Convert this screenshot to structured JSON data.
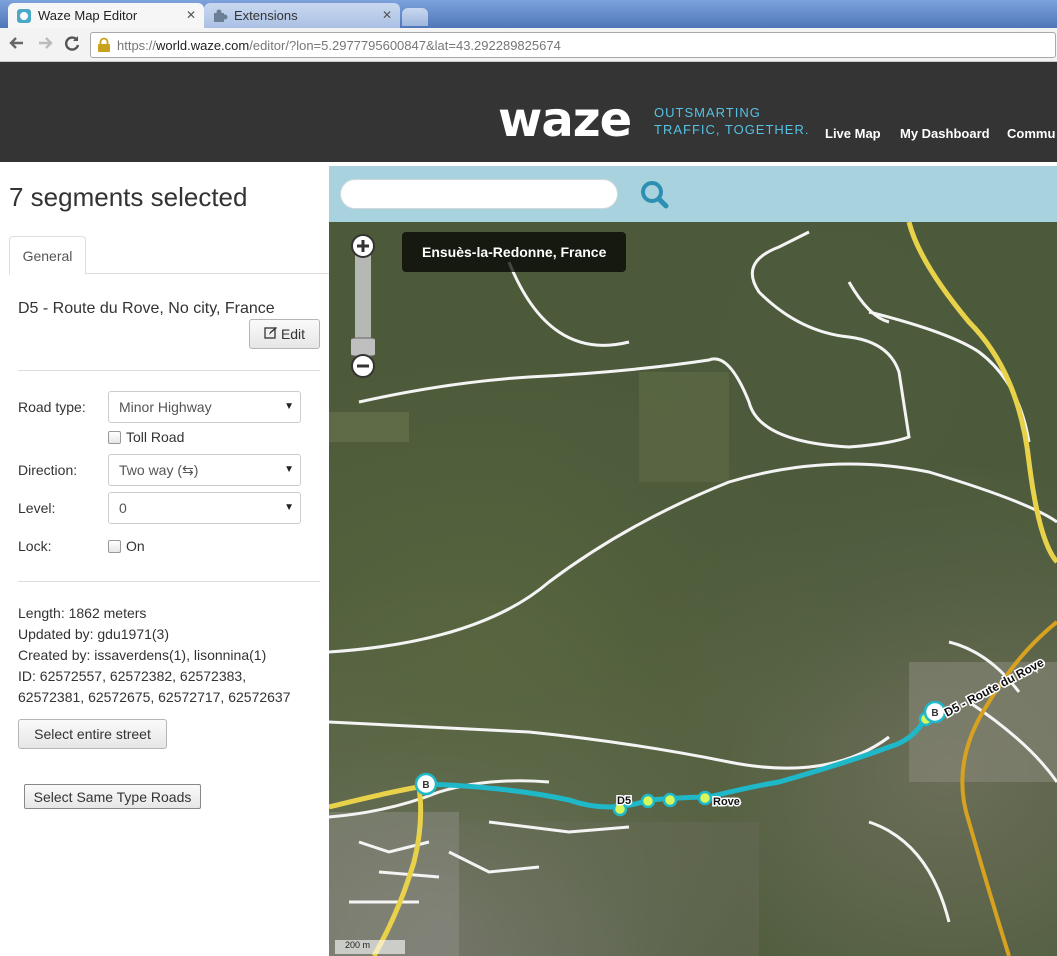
{
  "browser": {
    "tabs": [
      {
        "label": "Waze Map Editor",
        "active": true
      },
      {
        "label": "Extensions",
        "active": false
      }
    ],
    "url_scheme": "https://",
    "url_host": "world.waze.com",
    "url_path": "/editor/?lon=5.2977795600847&lat=43.292289825674"
  },
  "header": {
    "logo": "waze",
    "tagline_1": "OUTSMARTING",
    "tagline_2": "TRAFFIC, TOGETHER.",
    "nav": [
      "Live Map",
      "My Dashboard",
      "Commu"
    ]
  },
  "sidebar": {
    "title": "7 segments selected",
    "tab": "General",
    "road_name": "D5 - Route du Rove, No city, France",
    "edit_label": "Edit",
    "road_type_label": "Road type:",
    "road_type_value": "Minor Highway",
    "toll_label": "Toll Road",
    "direction_label": "Direction:",
    "direction_value": "Two way (⇆)",
    "level_label": "Level:",
    "level_value": "0",
    "lock_label": "Lock:",
    "lock_option": "On",
    "length": "Length: 1862 meters",
    "updated_by": "Updated by: gdu1971(3)",
    "created_by": "Created by: issaverdens(1), lisonnina(1)",
    "id_line1": "ID: 62572557, 62572382, 62572383,",
    "id_line2": "62572381, 62572675, 62572717, 62572637",
    "select_street_label": "Select entire street",
    "select_same_label": "Select Same Type Roads"
  },
  "map": {
    "city_label": "Ensuès-la-Redonne, France",
    "road_label_east": "D5 - Route du Rove",
    "road_label_mid_a": "D5",
    "road_label_mid_b": "Rove",
    "node_label": "B",
    "scale": "200 m"
  },
  "colors": {
    "selected_segment": "#1fb8c9",
    "highway": "#e8d24a",
    "header_bg": "#343434",
    "search_bar_bg": "#a8d3de"
  }
}
